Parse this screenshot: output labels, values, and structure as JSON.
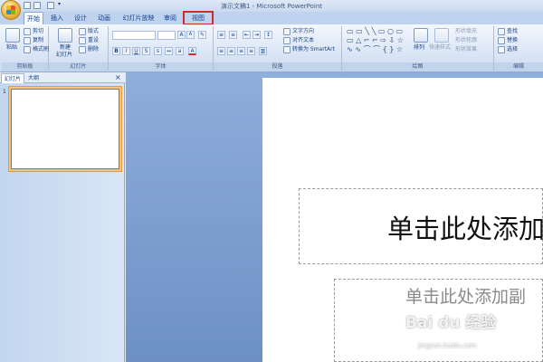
{
  "window": {
    "title": "演示文稿1 - Microsoft PowerPoint"
  },
  "tabs": [
    "开始",
    "插入",
    "设计",
    "动画",
    "幻灯片放映",
    "审阅",
    "视图"
  ],
  "ribbon": {
    "clipboard": {
      "label": "剪贴板",
      "paste": "粘贴",
      "cut": "剪切",
      "copy": "复制",
      "format_painter": "格式刷"
    },
    "slides": {
      "label": "幻灯片",
      "new_slide": "新建",
      "new_slide2": "幻灯片",
      "layout": "版式",
      "reset": "重设",
      "delete": "删除"
    },
    "font": {
      "label": "字体",
      "bold": "B",
      "italic": "I",
      "underline": "U",
      "strike": "S",
      "grow": "A",
      "shrink": "A"
    },
    "paragraph": {
      "label": "段落",
      "text_direction": "文字方向",
      "align_text": "对齐文本",
      "smartart": "转换为 SmartArt"
    },
    "drawing": {
      "label": "绘图",
      "arrange": "排列",
      "quick_styles": "快速样式",
      "fill": "形状填充",
      "outline": "形状轮廓",
      "effects": "形状效果"
    },
    "editing": {
      "label": "编辑",
      "find": "查找",
      "replace": "替换",
      "select": "选择"
    }
  },
  "left_pane": {
    "tab_slides": "幻灯片",
    "tab_outline": "大纲",
    "close": "×",
    "slide_number": "1"
  },
  "slide": {
    "title_placeholder": "单击此处添加",
    "subtitle_placeholder": "单击此处添加副"
  },
  "watermark": {
    "brand": "Bai du 经验",
    "url": "jingyan.baidu.com"
  }
}
